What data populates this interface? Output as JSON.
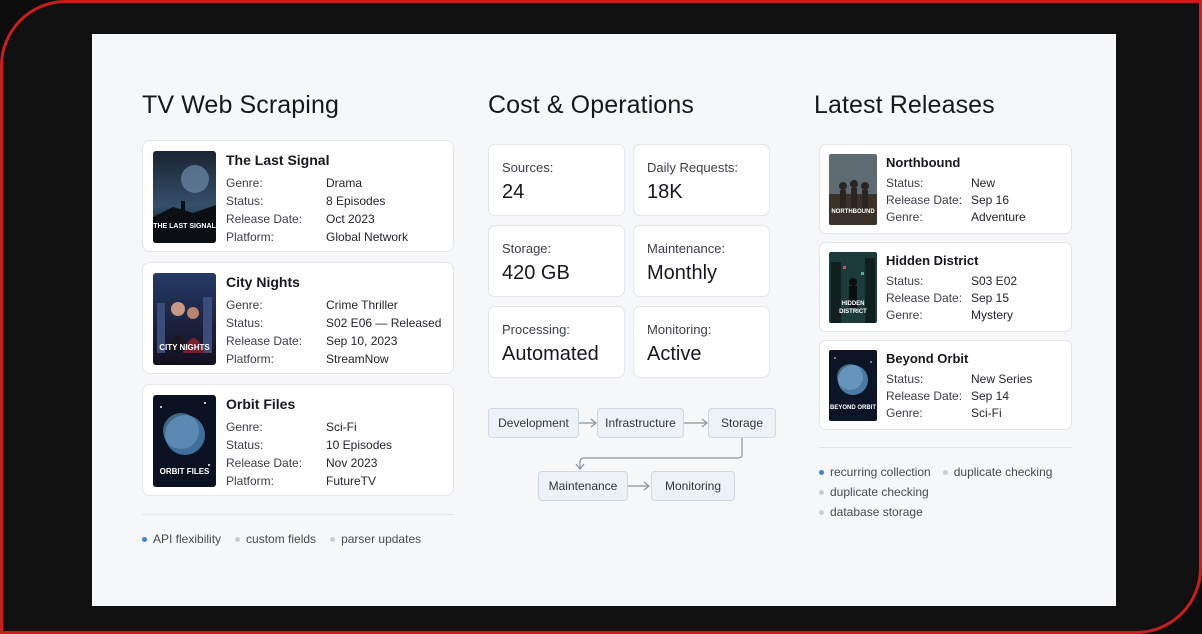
{
  "left": {
    "title": "TV Web Scraping",
    "shows": [
      {
        "name": "The Last Signal",
        "poster_text": "THE LAST SIGNAL",
        "rows": [
          {
            "k": "Genre:",
            "v": "Drama"
          },
          {
            "k": "Status:",
            "v": "8 Episodes"
          },
          {
            "k": "Release Date:",
            "v": "Oct 2023"
          },
          {
            "k": "Platform:",
            "v": "Global Network"
          }
        ]
      },
      {
        "name": "City Nights",
        "poster_text": "CITY NIGHTS",
        "rows": [
          {
            "k": "Genre:",
            "v": "Crime Thriller"
          },
          {
            "k": "Status:",
            "v": "S02 E06 — Released"
          },
          {
            "k": "Release Date:",
            "v": "Sep 10, 2023"
          },
          {
            "k": "Platform:",
            "v": "StreamNow"
          }
        ]
      },
      {
        "name": "Orbit Files",
        "poster_text": "ORBIT FILES",
        "rows": [
          {
            "k": "Genre:",
            "v": "Sci-Fi"
          },
          {
            "k": "Status:",
            "v": "10 Episodes"
          },
          {
            "k": "Release Date:",
            "v": "Nov 2023"
          },
          {
            "k": "Platform:",
            "v": "FutureTV"
          }
        ]
      }
    ],
    "tags": [
      "API flexibility",
      "custom fields",
      "parser updates"
    ]
  },
  "mid": {
    "title": "Cost & Operations",
    "stats": [
      {
        "label": "Sources:",
        "value": "24"
      },
      {
        "label": "Daily Requests:",
        "value": "18K"
      },
      {
        "label": "Storage:",
        "value": "420 GB"
      },
      {
        "label": "Maintenance:",
        "value": "Monthly"
      },
      {
        "label": "Processing:",
        "value": "Automated"
      },
      {
        "label": "Monitoring:",
        "value": "Active"
      }
    ],
    "flow": [
      "Development",
      "Infrastructure",
      "Storage",
      "Maintenance",
      "Monitoring"
    ]
  },
  "right": {
    "title": "Latest Releases",
    "releases": [
      {
        "name": "Northbound",
        "poster_text": "NORTHBOUND",
        "rows": [
          {
            "k": "Status:",
            "v": "New"
          },
          {
            "k": "Release Date:",
            "v": "Sep 16"
          },
          {
            "k": "Genre:",
            "v": "Adventure"
          }
        ]
      },
      {
        "name": "Hidden District",
        "poster_text": "HIDDEN DISTRICT",
        "rows": [
          {
            "k": "Status:",
            "v": "S03 E02"
          },
          {
            "k": "Release Date:",
            "v": "Sep 15"
          },
          {
            "k": "Genre:",
            "v": "Mystery"
          }
        ]
      },
      {
        "name": "Beyond Orbit",
        "poster_text": "BEYOND ORBIT",
        "rows": [
          {
            "k": "Status:",
            "v": "New Series"
          },
          {
            "k": "Release Date:",
            "v": "Sep 14"
          },
          {
            "k": "Genre:",
            "v": "Sci-Fi"
          }
        ]
      }
    ],
    "tags": [
      "recurring collection",
      "duplicate checking",
      "duplicate checking",
      "database storage"
    ]
  },
  "colors": {
    "accent_dot": "#4a7fd1",
    "frame_border": "#c81e1e",
    "panel_bg": "#f6f7f9"
  }
}
